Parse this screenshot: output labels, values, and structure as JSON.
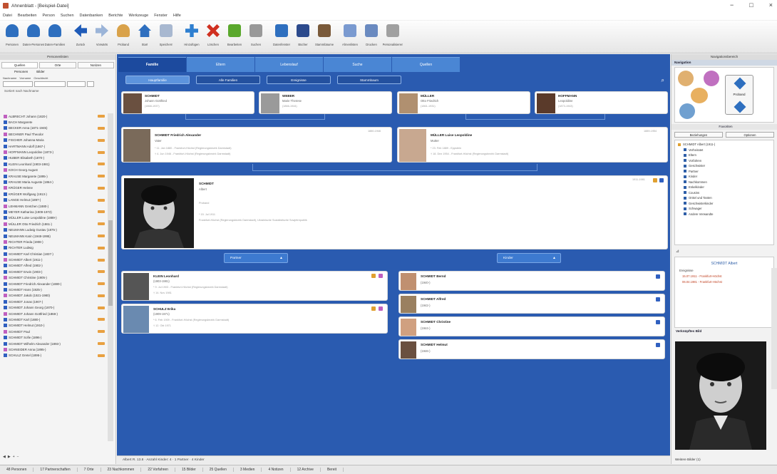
{
  "window": {
    "title": "Ahnenblatt - [Beispiel-Datei]",
    "min": "−",
    "max": "□",
    "close": "×"
  },
  "menu": [
    "Datei",
    "Bearbeiten",
    "Person",
    "Suchen",
    "Datenbanken",
    "Berichte",
    "Werkzeuge",
    "Fenster",
    "Hilfe"
  ],
  "toolbar": {
    "buttons": [
      {
        "label": "Personen",
        "icon": "person-edit-icon",
        "color": "#2e6fbf"
      },
      {
        "label": "Daten-Personen",
        "icon": "persons-icon",
        "color": "#2e6fbf"
      },
      {
        "label": "Daten-Familien",
        "icon": "family-icon",
        "color": "#2e6fbf"
      },
      {
        "label": "Zurück",
        "icon": "back-arrow-icon",
        "color": "#1f5bb8"
      },
      {
        "label": "Vorwärts",
        "icon": "forward-arrow-icon",
        "color": "#9bb4d8"
      },
      {
        "label": "Proband",
        "icon": "proband-icon",
        "color": "#d9a24a"
      },
      {
        "label": "Start",
        "icon": "home-icon",
        "color": "#2e6fbf"
      },
      {
        "label": "Speichern",
        "icon": "save-icon",
        "color": "#a8b8d0"
      },
      {
        "label": "Hinzufügen",
        "icon": "add-icon",
        "color": "#2e7fd0"
      },
      {
        "label": "Löschen",
        "icon": "delete-icon",
        "color": "#d03020"
      },
      {
        "label": "Bearbeiten",
        "icon": "edit-icon",
        "color": "#5aa82c"
      },
      {
        "label": "Suchen",
        "icon": "search-icon",
        "color": "#999999"
      },
      {
        "label": "Datenfenster",
        "icon": "export-icon",
        "color": "#2e6fbf"
      },
      {
        "label": "Bücher",
        "icon": "book-icon",
        "color": "#2c4a8c"
      },
      {
        "label": "Stammbäume",
        "icon": "tree-icon",
        "color": "#7a5a3a"
      },
      {
        "label": "Ahnenlisten",
        "icon": "document-icon",
        "color": "#7a9ad0"
      },
      {
        "label": "Drucken",
        "icon": "print-icon",
        "color": "#6a8ac0"
      },
      {
        "label": "Personalisieren",
        "icon": "tools-icon",
        "color": "#a0a0a0"
      }
    ]
  },
  "left_panel": {
    "header": "Personenlisten",
    "tabs": [
      "Quellen",
      "Orte",
      "Notizen"
    ],
    "subtabs": [
      "Personen",
      "Bilder"
    ],
    "filter_labels": [
      "Nachname",
      "Vorname",
      "Geschlecht"
    ],
    "sort_label": "Sortiert nach Nachname",
    "persons": [
      "ALBRECHT Johann (1820-)",
      "BACH Margarete",
      "BECKER Anna (1871-1945)",
      "BECHNER Paul Theodor",
      "FISCHER Johanna Maria",
      "HARTMANN Adolf (1867-)",
      "HOFFMANN Leopoldine (1873-)",
      "HUBER Elisabeth (1870-)",
      "KLEIN Leonhard (1903-1981)",
      "KOCH Georg August",
      "KRAUSE Margarete (1895-)",
      "KRAUSE Maria Auguste (1864-)",
      "KRÜGER Helene",
      "KRÜGER Wolfgang (1913-)",
      "LANGE Helmut (1897-)",
      "LEHMANN Gretchen (1880-)",
      "MEYER Katharina (1909-1972)",
      "MÜLLER Luise Leopoldine (1889-)",
      "MÜLLER Otto Friedrich (1861-)",
      "NEUMANN Ludwig Gustav (1875-)",
      "NEUMANN Karin (1948-1995)",
      "RICHTER Frieda (1908-)",
      "RICHTER Ludwig",
      "SCHMIDT Karl Christian (1837-)",
      "SCHMIDT Albert (1911-)",
      "SCHMIDT Alfred (1902-)",
      "SCHMIDT Erwin (1903-)",
      "SCHMIDT Christine (1905-)",
      "SCHMIDT Friedrich Alexander (1880-)",
      "SCHMIDT Hans (1925-)",
      "SCHMIDT Jakob (1921-1980)",
      "SCHMIDT Jonas (1907-)",
      "SCHMIDT Johann Georg (1870-)",
      "SCHMIDT Johann Gottfried (1868-)",
      "SCHMIDT Karl (1880-)",
      "SCHMIDT Helmut (1910-)",
      "SCHMIDT Paul",
      "SCHMIDT Sofie (1896-)",
      "SCHMIDT Wilhelm Alexander (1893-)",
      "SCHNEIDER Anna (1895-)",
      "SCHULZ Gretel (1895-)"
    ],
    "bottom": [
      "◀",
      "▶",
      "+",
      "−"
    ]
  },
  "main": {
    "tabs": [
      "Familie",
      "Eltern",
      "Lebenslauf",
      "Suche",
      "Quellen"
    ],
    "subtabs": [
      "Hauptfamilie",
      "Alle Familien",
      "Ereignisse",
      "Stammbaum"
    ],
    "grandparents": [
      {
        "name": "SCHMIDT",
        "sub": "Johann Gottfried",
        "date": "(1868-1937)"
      },
      {
        "name": "WEBER",
        "sub": "Marie Therese",
        "date": "(1866-1944)"
      },
      {
        "name": "MÜLLER",
        "sub": "Otto Friedrich",
        "date": "(1861-1931)"
      },
      {
        "name": "HOFFMANN",
        "sub": "Leopoldine",
        "date": "(1873-1943)"
      }
    ],
    "parents": [
      {
        "name": "SCHMIDT Friedrich Alexander",
        "sub": "Vater",
        "l1": "* 11. Jan 1880 - Frankfurt-Höchst (Regierungsbezirk Darmstadt)",
        "l2": "† 4. Jun 1946 - Frankfurt-Höchst (Regierungsbezirk Darmstadt)",
        "date": "1880-1946"
      },
      {
        "name": "MÜLLER Luise Leopoldine",
        "sub": "Mutter",
        "l1": "* 23. Feb 1889 - Eppstein",
        "l2": "† 18. Dez 1954 - Frankfurt-Höchst (Regierungsbezirk Darmstadt)",
        "date": "1889-1954"
      }
    ],
    "main_person": {
      "name": "SCHMIDT",
      "first": "Albert",
      "role": "Proband",
      "birth": "* 15. Jul 1911",
      "place": "Frankfurt-Höchst (Regierungsbezirk Darmstadt), Ukrainische Sozialistische Sowjetrepublik",
      "date": "1911-1981"
    },
    "spouse_btn": "Partner",
    "children_btn": "Kinder",
    "spouses": [
      {
        "name": "KLEIN Leonhard",
        "sub": "(1903-1981)",
        "l1": "* 9. Jul 1903 - Frankfurt-Höchst (Regierungsbezirk Darmstadt)",
        "l2": "† 14. Nov 1981"
      },
      {
        "name": "SCHULZ Erika",
        "sub": "(1909-1971)",
        "l1": "* 6. Feb 1909 - Frankfurt-Höchst (Regierungsbezirk Darmstadt)",
        "l2": "† 12. Okt 1971"
      }
    ],
    "children": [
      {
        "name": "SCHMIDT Bernd",
        "sub": "(1940-)"
      },
      {
        "name": "SCHMIDT Alfred",
        "sub": "(1942-)"
      },
      {
        "name": "SCHMIDT Christine",
        "sub": "(1944-)"
      },
      {
        "name": "SCHMIDT Helmut",
        "sub": "(1946-)"
      }
    ],
    "status": "Albert R. 13.8  ·  Anzahl Kinder: 4  ·  1 Partner  ·  4 Kinder"
  },
  "right_panel": {
    "header": "Navigationsbereich",
    "nav_title": "Navigation",
    "nav_btn": "Proband",
    "nav2_title": "Favoriten",
    "tabs": [
      "Beziehungen",
      "Optionen"
    ],
    "tree": [
      "SCHMIDT Albert (1911-)",
      "Verheiratet",
      "Eltern",
      "Vorfahren",
      "Geschwister",
      "Partner",
      "Kinder",
      "Nachkommen",
      "Enkelkinder",
      "Cousins",
      "Onkel und Tanten",
      "Geschwisterkinder",
      "Schwager",
      "Andere Verwandte"
    ],
    "detail_title": "SCHMIDT Albert",
    "detail_label": "Ereignisse",
    "detail_events": [
      "15.07.1911 - Frankfurt-Höchst",
      "06.04.1981 - Frankfurt-Höchst"
    ],
    "photo_title": "Verknüpftes Bild",
    "footer": "Weitere Bilder (1)"
  },
  "statusbar": [
    "48 Personen",
    "17 Partnerschaften",
    "7 Orte",
    "23 Nachkommen",
    "22 Vorfahren",
    "15 Bilder",
    "25 Quellen",
    "3 Medien",
    "4 Notizen",
    "12 Archive",
    "Bereit"
  ],
  "colors": {
    "main_bg": "#2a5bb0",
    "tab": "#4a86d4",
    "active_tab": "#1c4a9e",
    "female": "#c060c0",
    "male": "#3060c0"
  }
}
